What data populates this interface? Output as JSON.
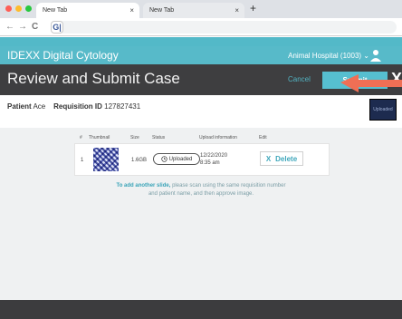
{
  "browser": {
    "tabs": [
      {
        "label": "New Tab",
        "close": "×"
      },
      {
        "label": "New Tab",
        "close": "×"
      }
    ],
    "new_tab": "+",
    "nav": {
      "back": "←",
      "forward": "→",
      "reload": "C"
    },
    "address_text": "G|"
  },
  "app": {
    "brand": "IDEXX Digital Cytology",
    "hospital": "Animal Hospital (1003)",
    "hospital_caret": "⌄"
  },
  "review": {
    "title": "Review and Submit Case",
    "cancel_label": "Cancel",
    "submit_label": "Submit",
    "close_label": "X"
  },
  "patient": {
    "patient_label": "Patient",
    "patient_name": "Ace",
    "requisition_label": "Requisition ID",
    "requisition_id": "127827431",
    "thumb_label": "Uploaded"
  },
  "table": {
    "headers": [
      "#",
      "Thumbnail",
      "Size",
      "Status",
      "Upload information",
      "Edit"
    ],
    "rows": [
      {
        "num": "1",
        "size": "1.6GB",
        "status": "Uploaded",
        "date": "12/22/2020",
        "time": "8:35 am",
        "delete_icon": "X",
        "delete_label": "Delete"
      }
    ]
  },
  "hint": {
    "bold": "To add another slide,",
    "rest1": " please scan using the same requisition number",
    "rest2": "and patient name, and then approve image."
  },
  "colors": {
    "teal": "#57bac9",
    "dark_bar": "#3e3e40",
    "submit": "#56bfd0",
    "arrow": "#ef6f55"
  }
}
